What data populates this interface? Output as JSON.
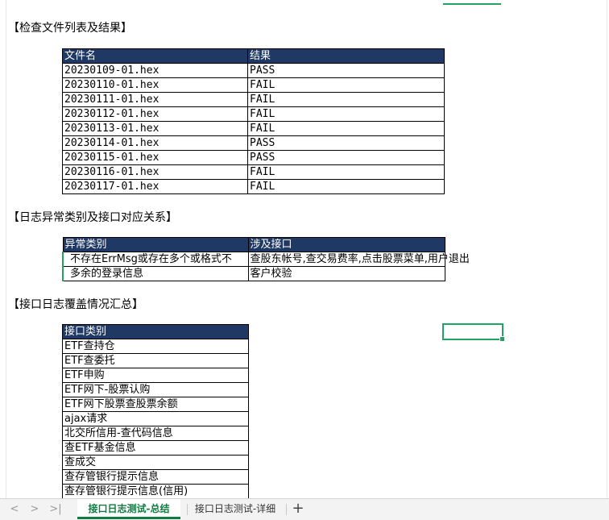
{
  "sections": {
    "files": {
      "title": "【检查文件列表及结果】",
      "headers": [
        "文件名",
        "结果"
      ],
      "rows": [
        [
          "20230109-01.hex",
          "PASS"
        ],
        [
          "20230110-01.hex",
          "FAIL"
        ],
        [
          "20230111-01.hex",
          "FAIL"
        ],
        [
          "20230112-01.hex",
          "FAIL"
        ],
        [
          "20230113-01.hex",
          "FAIL"
        ],
        [
          "20230114-01.hex",
          "PASS"
        ],
        [
          "20230115-01.hex",
          "PASS"
        ],
        [
          "20230116-01.hex",
          "FAIL"
        ],
        [
          "20230117-01.hex",
          "FAIL"
        ]
      ]
    },
    "anomalies": {
      "title": "【日志异常类别及接口对应关系】",
      "headers": [
        "异常类别",
        "涉及接口"
      ],
      "rows": [
        [
          "不存在ErrMsg或存在多个或格式不",
          "查股东帐号,查交易费率,点击股票菜单,用户退出"
        ],
        [
          "多余的登录信息",
          "客户校验"
        ]
      ]
    },
    "coverage": {
      "title": "【接口日志覆盖情况汇总】",
      "header": "接口类别",
      "rows": [
        "ETF查持仓",
        "ETF查委托",
        "ETF申购",
        "ETF网下-股票认购",
        "ETF网下股票查股票余额",
        "ajax请求",
        "北交所信用-查代码信息",
        "查ETF基金信息",
        "查成交",
        "查存管银行提示信息",
        "查存管银行提示信息(信用)"
      ]
    }
  },
  "tabs": [
    {
      "label": "接口日志测试-总结",
      "active": true
    },
    {
      "label": "接口日志测试-详细",
      "active": false
    }
  ],
  "nav": {
    "first": "|<",
    "prev": "<",
    "next": ">",
    "last": ">|",
    "add": "+"
  },
  "colors": {
    "header_bg": "#1f3864",
    "accent": "#107c41",
    "selection": "#21a366"
  }
}
